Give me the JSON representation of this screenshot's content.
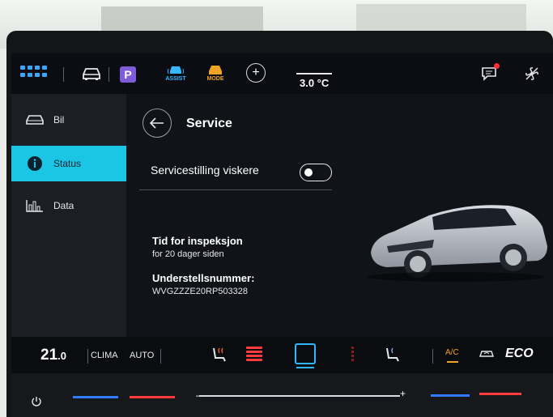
{
  "topbar": {
    "assist_label": "ASSIST",
    "mode_label": "MODE",
    "parking_label": "P",
    "plus_label": "+",
    "temperature": "3.0 °C"
  },
  "sidebar": {
    "items": [
      {
        "label": "Bil",
        "icon": "car-icon",
        "active": false
      },
      {
        "label": "Status",
        "icon": "info-icon",
        "active": true
      },
      {
        "label": "Data",
        "icon": "bar-chart-icon",
        "active": false
      }
    ]
  },
  "main": {
    "title": "Service",
    "wiper_service_label": "Servicestilling viskere",
    "wiper_service_on": false,
    "inspection_heading": "Tid for inspeksjon",
    "inspection_detail": "for 20 dager siden",
    "vin_heading": "Understellsnummer:",
    "vin_value": "WVGZZZE20RP503328"
  },
  "climate": {
    "temp_whole": "21",
    "temp_decimal": ".0",
    "clima_label": "CLIMA",
    "auto_label": "AUTO",
    "ac_label": "A/C",
    "eco_label": "ECO"
  },
  "colors": {
    "accent": "#1ac6e4",
    "assist": "#34b8ff",
    "mode": "#f0a324",
    "heat": "#ff3b3b",
    "notification": "#ff2e3a"
  }
}
